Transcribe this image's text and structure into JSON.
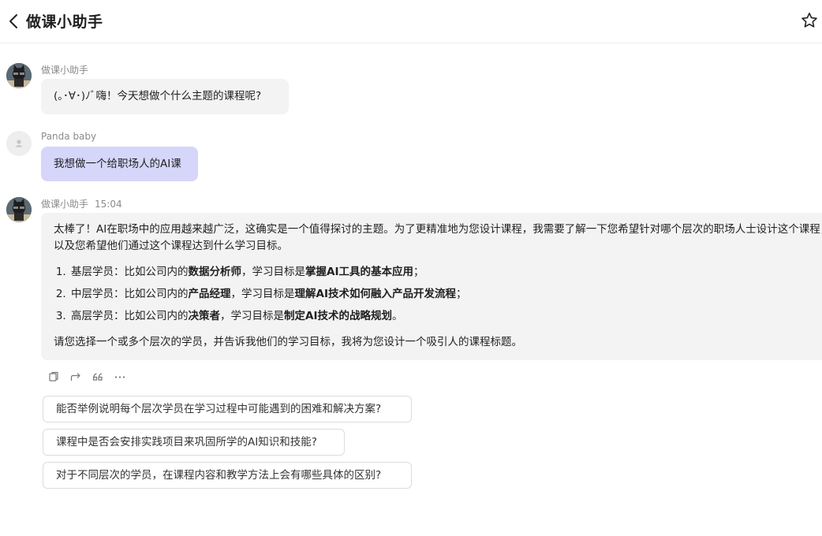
{
  "header": {
    "title": "做课小助手"
  },
  "messages": [
    {
      "sender": "做课小助手",
      "text": "(｡･∀･)ﾉﾞ嗨！今天想做个什么主题的课程呢?"
    },
    {
      "sender": "Panda baby",
      "text": "我想做一个给职场人的AI课"
    },
    {
      "sender": "做课小助手",
      "time": "15:04",
      "intro": "太棒了！AI在职场中的应用越来越广泛，这确实是一个值得探讨的主题。为了更精准地为您设计课程，我需要了解一下您希望针对哪个层次的职场人士设计这个课程，以及您希望他们通过这个课程达到什么学习目标。",
      "items": [
        {
          "prefix": "基层学员：比如公司内的",
          "role": "数据分析师",
          "mid": "，学习目标是",
          "goal": "掌握AI工具的基本应用",
          "suffix": "；"
        },
        {
          "prefix": "中层学员：比如公司内的",
          "role": "产品经理",
          "mid": "，学习目标是",
          "goal": "理解AI技术如何融入产品开发流程",
          "suffix": "；"
        },
        {
          "prefix": "高层学员：比如公司内的",
          "role": "决策者",
          "mid": "，学习目标是",
          "goal": "制定AI技术的战略规划",
          "suffix": "。"
        }
      ],
      "outro": "请您选择一个或多个层次的学员，并告诉我他们的学习目标，我将为您设计一个吸引人的课程标题。"
    }
  ],
  "actions": [
    "copy-icon",
    "share-icon",
    "quote-icon",
    "more-icon"
  ],
  "suggestions": [
    "能否举例说明每个层次学员在学习过程中可能遇到的困难和解决方案?",
    "课程中是否会安排实践项目来巩固所学的AI知识和技能?",
    "对于不同层次的学员，在课程内容和教学方法上会有哪些具体的区别?"
  ],
  "colors": {
    "user_bubble": "#d6d6fb",
    "bot_bubble": "#f3f3f3",
    "suggestion_border": "#dcdcdc"
  }
}
